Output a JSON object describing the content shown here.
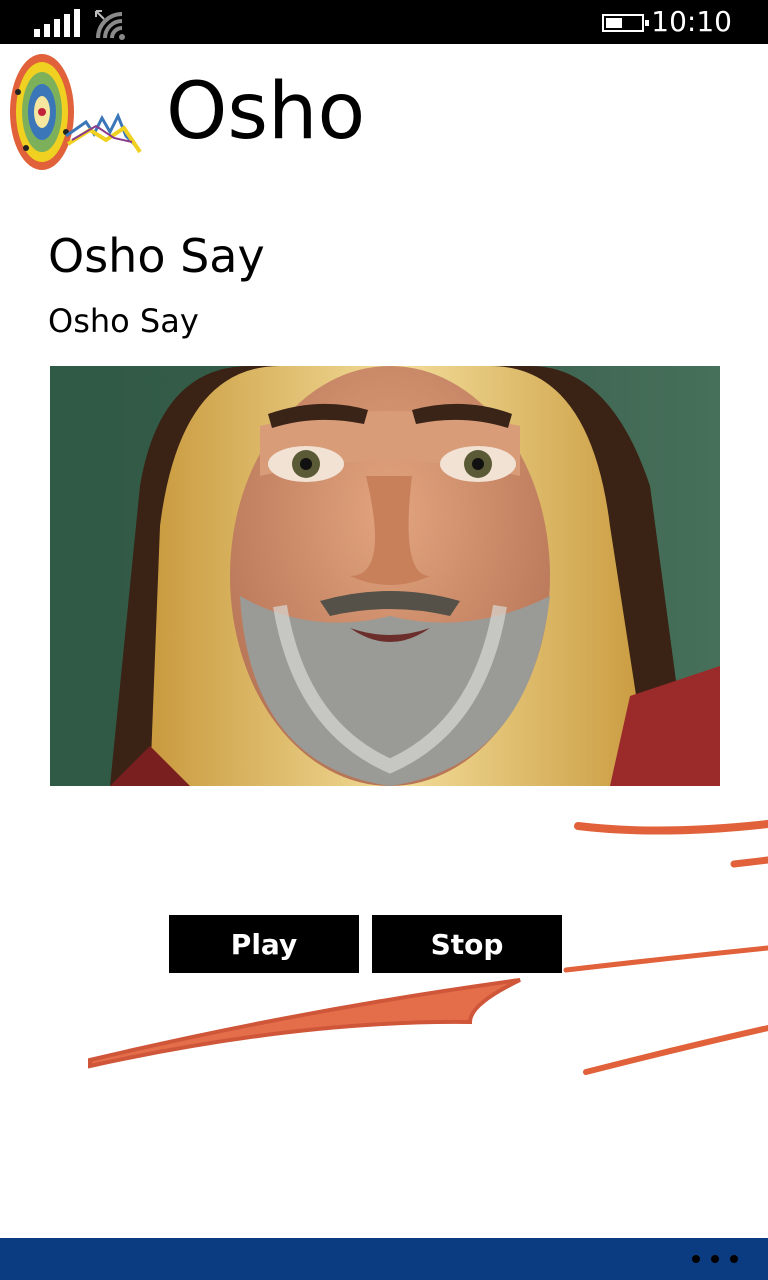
{
  "status_bar": {
    "time": "10:10",
    "icons": [
      "signal-icon",
      "wifi-icon",
      "battery-icon"
    ]
  },
  "header": {
    "title": "Osho",
    "logo_icon": "mandala-logo-icon"
  },
  "content": {
    "title": "Osho Say",
    "subtitle": "Osho Say",
    "image": "osho-portrait"
  },
  "controls": {
    "play_label": "Play",
    "stop_label": "Stop"
  },
  "app_bar": {
    "more_icon": "ellipsis-icon"
  },
  "colors": {
    "status_bar": "#000000",
    "background": "#ffffff",
    "button": "#000000",
    "button_text": "#ffffff",
    "app_bar": "#0b3c82",
    "brush_stroke": "#e0613a"
  }
}
